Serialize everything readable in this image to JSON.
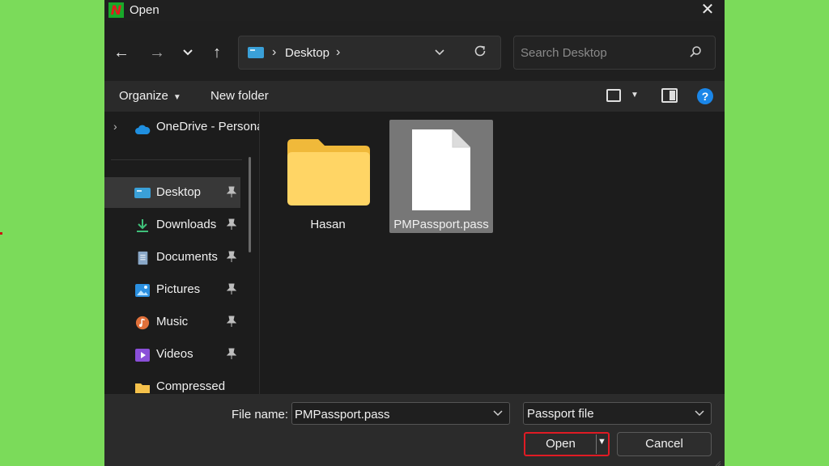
{
  "window": {
    "title": "Open",
    "app_icon_letter": "N",
    "close_glyph": "✕"
  },
  "nav": {
    "back_glyph": "←",
    "forward_glyph": "→",
    "recent_glyph": "⌄",
    "up_glyph": "↑",
    "address_segments": [
      "Desktop"
    ],
    "separator": "›",
    "refresh_glyph": "↻",
    "dropdown_glyph": "⌄"
  },
  "search": {
    "placeholder": "Search Desktop",
    "value": ""
  },
  "command_bar": {
    "organize_label": "Organize",
    "new_folder_label": "New folder",
    "help_label": "?"
  },
  "sidebar": {
    "items": [
      {
        "label": "OneDrive - Personal",
        "icon": "cloud-icon",
        "pinned": false
      },
      {
        "label": "Desktop",
        "icon": "desktop-icon",
        "pinned": true,
        "selected": true
      },
      {
        "label": "Downloads",
        "icon": "download-icon",
        "pinned": true
      },
      {
        "label": "Documents",
        "icon": "document-icon",
        "pinned": true
      },
      {
        "label": "Pictures",
        "icon": "picture-icon",
        "pinned": true
      },
      {
        "label": "Music",
        "icon": "music-icon",
        "pinned": true
      },
      {
        "label": "Videos",
        "icon": "video-icon",
        "pinned": true
      },
      {
        "label": "Compressed",
        "icon": "folder-icon",
        "pinned": false
      }
    ],
    "pin_glyph": "📌"
  },
  "files": [
    {
      "name": "Hasan",
      "type": "folder",
      "selected": false
    },
    {
      "name": "PMPassport.pass",
      "type": "file",
      "selected": true
    }
  ],
  "footer": {
    "file_name_label": "File name:",
    "file_name_value": "PMPassport.pass",
    "file_type_value": "Passport file",
    "open_label": "Open",
    "cancel_label": "Cancel"
  },
  "colors": {
    "background": "#7bdb5a",
    "dialog": "#1c1c1c",
    "accent_blue": "#1a86e8",
    "highlight_red": "#e01b24"
  }
}
